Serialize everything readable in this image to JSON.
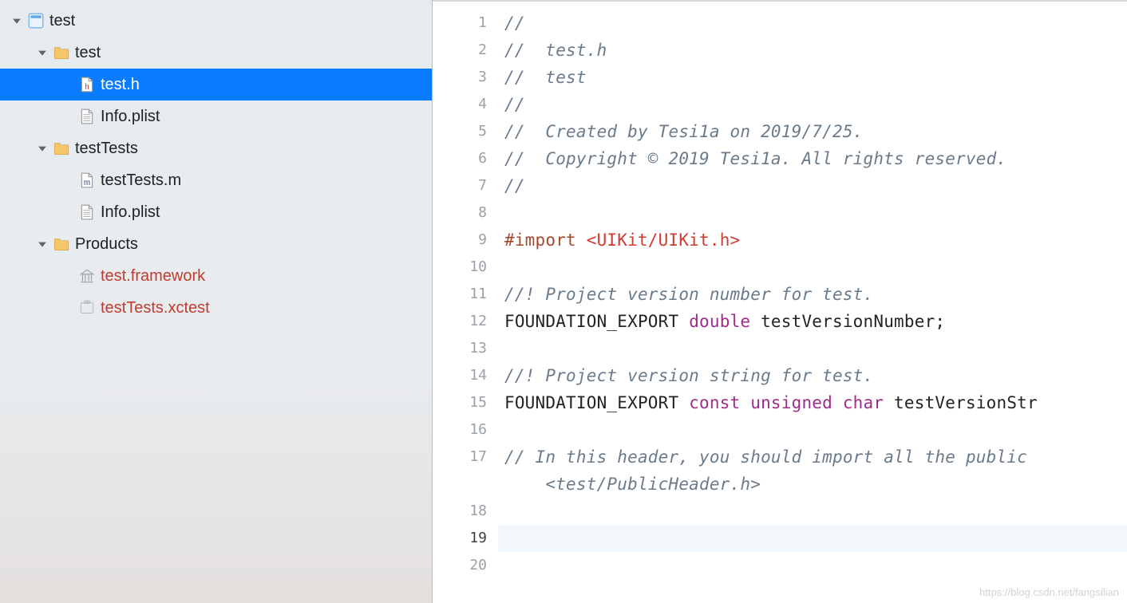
{
  "navigator": {
    "project": {
      "name": "test"
    },
    "tree": [
      {
        "id": "root",
        "depth": 0,
        "kind": "project",
        "label": "test",
        "expanded": true,
        "red": false,
        "selected": false
      },
      {
        "id": "grp-test",
        "depth": 1,
        "kind": "folder",
        "label": "test",
        "expanded": true,
        "red": false,
        "selected": false
      },
      {
        "id": "file-testh",
        "depth": 2,
        "kind": "h",
        "label": "test.h",
        "expanded": null,
        "red": false,
        "selected": true
      },
      {
        "id": "file-info1",
        "depth": 2,
        "kind": "plist",
        "label": "Info.plist",
        "expanded": null,
        "red": false,
        "selected": false
      },
      {
        "id": "grp-testtests",
        "depth": 1,
        "kind": "folder",
        "label": "testTests",
        "expanded": true,
        "red": false,
        "selected": false
      },
      {
        "id": "file-ttm",
        "depth": 2,
        "kind": "m",
        "label": "testTests.m",
        "expanded": null,
        "red": false,
        "selected": false
      },
      {
        "id": "file-info2",
        "depth": 2,
        "kind": "plist",
        "label": "Info.plist",
        "expanded": null,
        "red": false,
        "selected": false
      },
      {
        "id": "grp-products",
        "depth": 1,
        "kind": "folder",
        "label": "Products",
        "expanded": true,
        "red": false,
        "selected": false
      },
      {
        "id": "prod-fw",
        "depth": 2,
        "kind": "framework",
        "label": "test.framework",
        "expanded": null,
        "red": true,
        "selected": false
      },
      {
        "id": "prod-xctest",
        "depth": 2,
        "kind": "xctest",
        "label": "testTests.xctest",
        "expanded": null,
        "red": true,
        "selected": false
      }
    ]
  },
  "editor": {
    "filename": "test.h",
    "current_line": 19,
    "syntax_colors": {
      "comment": "#6a7b8c",
      "preprocessor": "#a6492d",
      "string": "#cf3b32",
      "keyword": "#a12b8a",
      "plain": "#232323"
    },
    "lines": [
      {
        "n": 1,
        "tokens": [
          {
            "t": "//",
            "c": "comment"
          }
        ]
      },
      {
        "n": 2,
        "tokens": [
          {
            "t": "//  test.h",
            "c": "comment"
          }
        ]
      },
      {
        "n": 3,
        "tokens": [
          {
            "t": "//  test",
            "c": "comment"
          }
        ]
      },
      {
        "n": 4,
        "tokens": [
          {
            "t": "//",
            "c": "comment"
          }
        ]
      },
      {
        "n": 5,
        "tokens": [
          {
            "t": "//  Created by Tesi1a on 2019/7/25.",
            "c": "comment"
          }
        ]
      },
      {
        "n": 6,
        "tokens": [
          {
            "t": "//  Copyright © 2019 Tesi1a. All rights reserved.",
            "c": "comment"
          }
        ]
      },
      {
        "n": 7,
        "tokens": [
          {
            "t": "//",
            "c": "comment"
          }
        ]
      },
      {
        "n": 8,
        "tokens": [
          {
            "t": "",
            "c": "plain"
          }
        ]
      },
      {
        "n": 9,
        "tokens": [
          {
            "t": "#import ",
            "c": "preproc"
          },
          {
            "t": "<UIKit/UIKit.h>",
            "c": "anglestr"
          }
        ]
      },
      {
        "n": 10,
        "tokens": [
          {
            "t": "",
            "c": "plain"
          }
        ]
      },
      {
        "n": 11,
        "tokens": [
          {
            "t": "//! Project version number for test.",
            "c": "comment"
          }
        ]
      },
      {
        "n": 12,
        "tokens": [
          {
            "t": "FOUNDATION_EXPORT ",
            "c": "plain"
          },
          {
            "t": "double",
            "c": "keyword"
          },
          {
            "t": " testVersionNumber;",
            "c": "plain"
          }
        ]
      },
      {
        "n": 13,
        "tokens": [
          {
            "t": "",
            "c": "plain"
          }
        ]
      },
      {
        "n": 14,
        "tokens": [
          {
            "t": "//! Project version string for test.",
            "c": "comment"
          }
        ]
      },
      {
        "n": 15,
        "tokens": [
          {
            "t": "FOUNDATION_EXPORT ",
            "c": "plain"
          },
          {
            "t": "const",
            "c": "keyword"
          },
          {
            "t": " ",
            "c": "plain"
          },
          {
            "t": "unsigned",
            "c": "keyword"
          },
          {
            "t": " ",
            "c": "plain"
          },
          {
            "t": "char",
            "c": "keyword"
          },
          {
            "t": " testVersionStr",
            "c": "plain"
          }
        ]
      },
      {
        "n": 16,
        "tokens": [
          {
            "t": "",
            "c": "plain"
          }
        ]
      },
      {
        "n": 17,
        "tokens": [
          {
            "t": "// In this header, you should import all the public ",
            "c": "comment"
          }
        ]
      },
      {
        "n": null,
        "cont": true,
        "tokens": [
          {
            "t": "    <test/PublicHeader.h>",
            "c": "comment"
          }
        ]
      },
      {
        "n": 18,
        "tokens": [
          {
            "t": "",
            "c": "plain"
          }
        ]
      },
      {
        "n": 19,
        "tokens": [
          {
            "t": "",
            "c": "plain"
          }
        ]
      },
      {
        "n": 20,
        "tokens": [
          {
            "t": "",
            "c": "plain"
          }
        ]
      }
    ]
  },
  "watermark": "https://blog.csdn.net/fangsilian"
}
